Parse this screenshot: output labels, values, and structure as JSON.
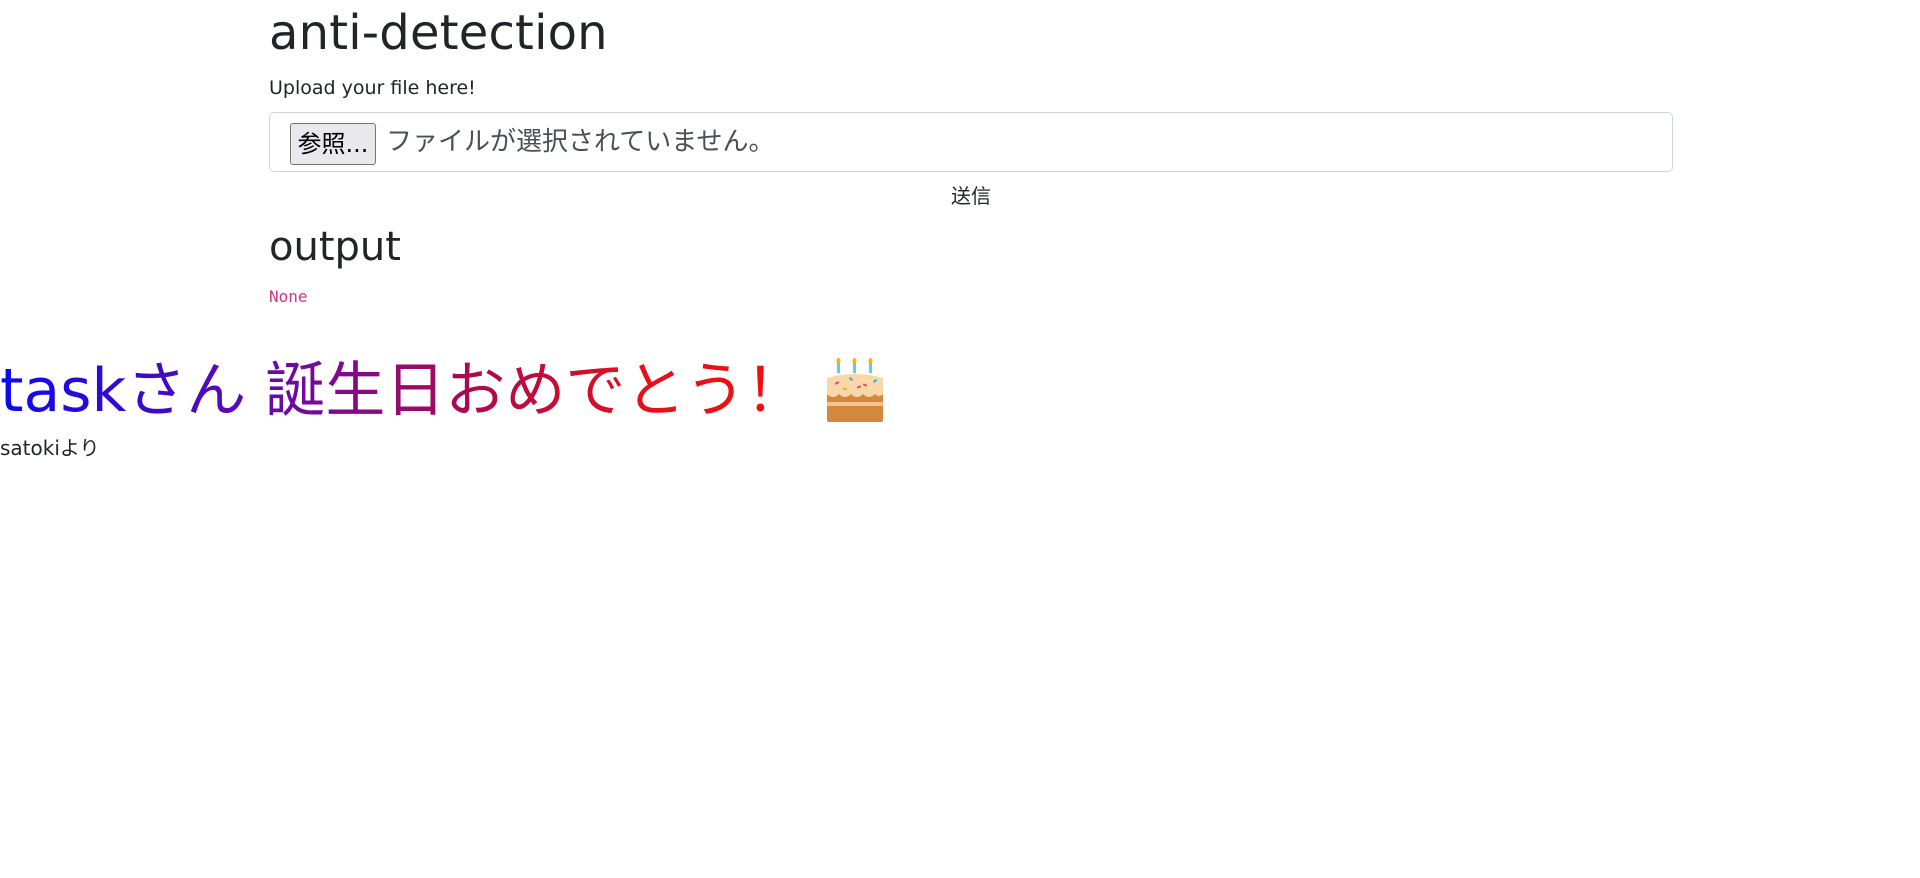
{
  "header": {
    "title": "anti-detection"
  },
  "upload": {
    "label": "Upload your file here!",
    "browse_label": "参照...",
    "file_status": "ファイルが選択されていません。",
    "submit_label": "送信"
  },
  "output": {
    "title": "output",
    "value": "None"
  },
  "greeting": {
    "message": "taskさん 誕生日おめでとう！",
    "icon": "birthday-cake-icon",
    "signature": "satokiより"
  },
  "colors": {
    "message_gradient_start": "#0a0af0",
    "message_gradient_end": "#f01010",
    "output_value": "#d63384"
  }
}
